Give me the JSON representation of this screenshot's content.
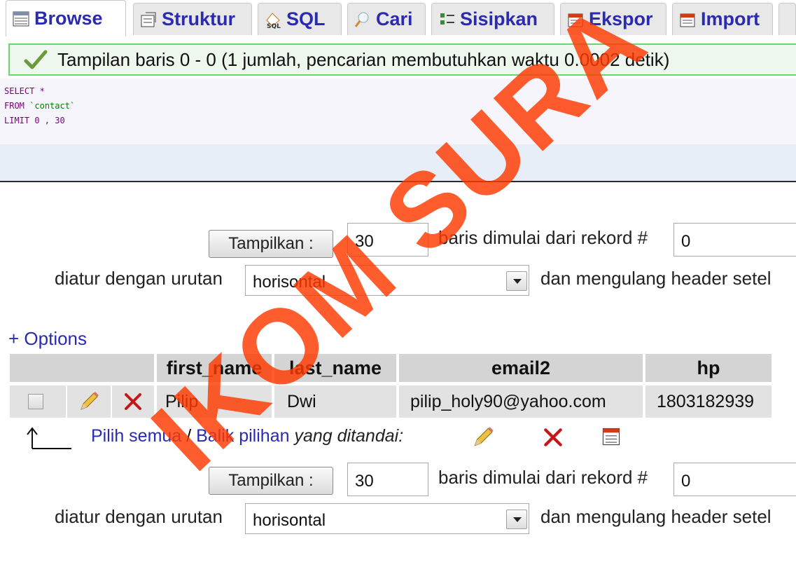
{
  "tabs": [
    {
      "label": "Browse",
      "icon": "browse-icon",
      "active": true
    },
    {
      "label": "Struktur",
      "icon": "structure-icon"
    },
    {
      "label": "SQL",
      "icon": "sql-icon"
    },
    {
      "label": "Cari",
      "icon": "search-icon"
    },
    {
      "label": "Sisipkan",
      "icon": "insert-icon"
    },
    {
      "label": "Ekspor",
      "icon": "export-icon"
    },
    {
      "label": "Import",
      "icon": "import-icon"
    }
  ],
  "message": "Tampilan baris 0 - 0 (1 jumlah, pencarian membutuhkan waktu 0.0002 detik)",
  "sql": {
    "line1": "SELECT *",
    "line2_kw": "FROM",
    "line2_tbl": "`contact`",
    "line3_kw": "LIMIT",
    "line3_nums": "0 , 30"
  },
  "nav": {
    "show_button": "Tampilkan :",
    "rows_value": "30",
    "start_label": "baris dimulai dari rekord #",
    "start_value": "0",
    "order_label": "diatur dengan urutan",
    "order_value": "horisontal",
    "repeat_label": "dan mengulang header setel"
  },
  "options_link": "+ Options",
  "table": {
    "headers": [
      "first_name",
      "last_name",
      "email2",
      "hp"
    ],
    "rows": [
      {
        "first_name": "Pilip",
        "last_name": "Dwi",
        "email2": "pilip_holy90@yahoo.com",
        "hp": "1803182939"
      }
    ]
  },
  "bulk": {
    "check_all": "Pilih semua",
    "separator": "/",
    "invert": "Balik pilihan",
    "marked_label": "yang ditandai:"
  },
  "watermark": "IKOM SURA",
  "colors": {
    "link": "#2a2ab2",
    "message_border": "#6fd46f",
    "watermark": "#ff3a00"
  }
}
